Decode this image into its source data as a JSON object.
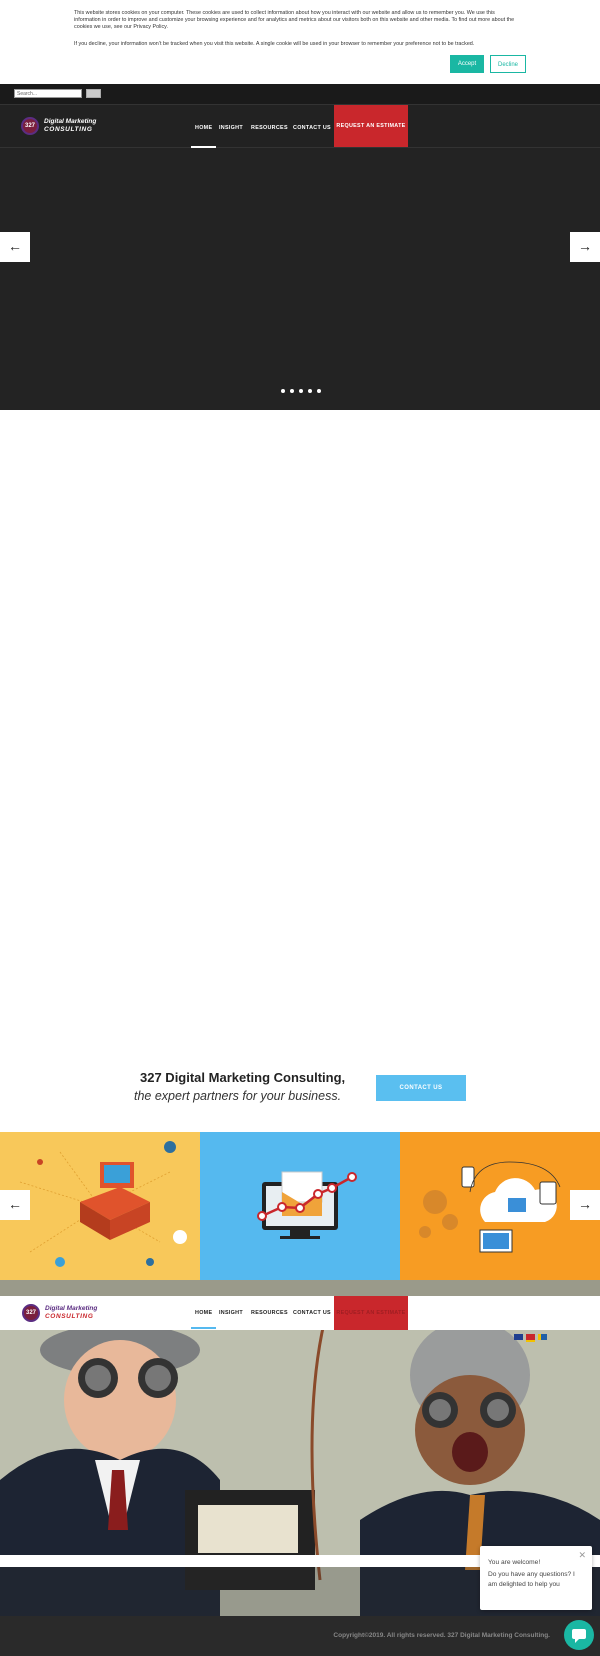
{
  "cookie": {
    "text1": "This website stores cookies on your computer. These cookies are used to collect information about how you interact with our website and allow us to remember you. We use this information in order to improve and customize your browsing experience and for analytics and metrics about our visitors both on this website and other media. To find out more about the cookies we use, see our Privacy Policy.",
    "text2": "If you decline, your information won’t be tracked when you visit this website. A single cookie will be used in your browser to remember your preference not to be tracked.",
    "accept_label": "Accept",
    "decline_label": "Decline"
  },
  "search": {
    "placeholder": "Search..."
  },
  "brand": {
    "line1": "Digital Marketing",
    "line2": "CONSULTING",
    "mark": "327"
  },
  "nav": {
    "items": [
      "HOME",
      "INSIGHT",
      "RESOURCES",
      "CONTACT US"
    ],
    "cta": "REQUEST AN ESTIMATE",
    "active": "HOME"
  },
  "slider": {
    "prev_icon": "arrow-left",
    "next_icon": "arrow-right",
    "dots": 5
  },
  "tagline": {
    "bold": "327 Digital Marketing Consulting,",
    "italic": "the expert partners for your business.",
    "cta": "CONTACT US"
  },
  "tiles": [
    {
      "name": "isometric-network-illustration",
      "color": "#f8c85a"
    },
    {
      "name": "email-chart-illustration",
      "color": "#55b9ef"
    },
    {
      "name": "cloud-devices-illustration",
      "color": "#f79c23"
    }
  ],
  "chat": {
    "line1": "You are welcome!",
    "line2": "Do you have any questions? I am delighted to help you"
  },
  "footer": {
    "copyright": "Copyright©2019. All rights reserved. 327 Digital Marketing Consulting."
  },
  "colors": {
    "accent": "#1ab7a3",
    "cta_red": "#c9272c",
    "contact_blue": "#5abff0"
  }
}
